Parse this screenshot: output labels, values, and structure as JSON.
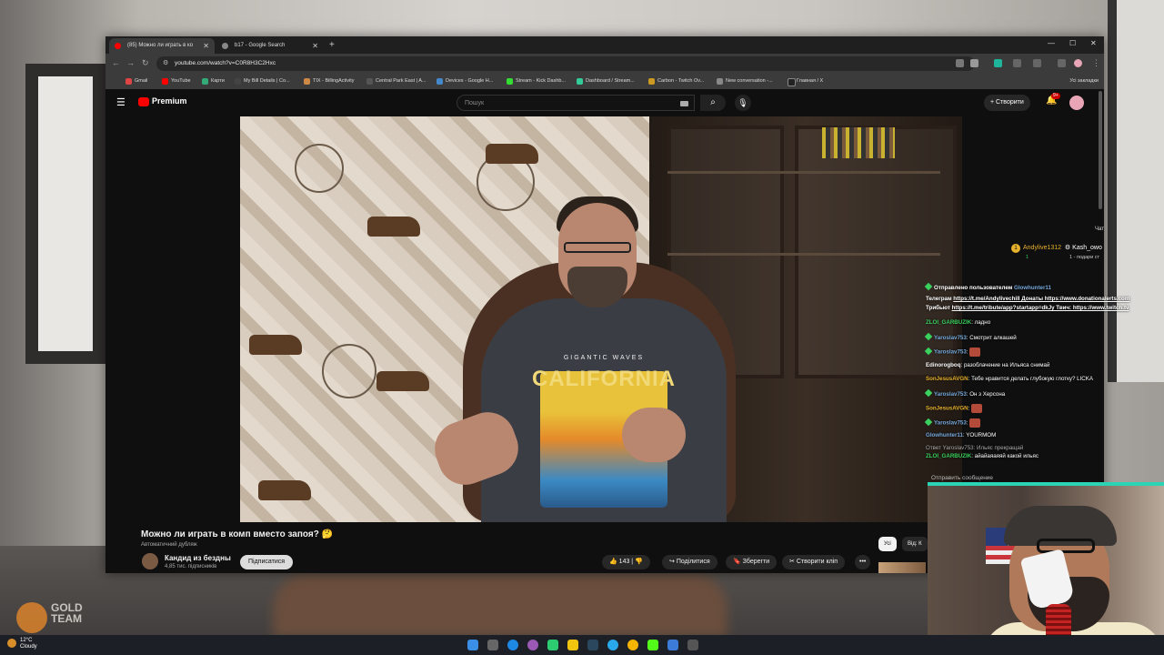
{
  "browser": {
    "tabs": [
      {
        "title": "(85) Можно ли играть в ко",
        "active": true
      },
      {
        "title": "b17 - Google Search",
        "active": false
      }
    ],
    "url": "youtube.com/watch?v=C0R8H3C2Hxc",
    "bookmarks": [
      "Gmail",
      "YouTube",
      "Карти",
      "My Bill Details | Co...",
      "TIX - BillingActivity",
      "Central Park East | A...",
      "Devices - Google H...",
      "Stream - Kick Dashb...",
      "Dashboard / Stream...",
      "Carbon - Twitch Ov...",
      "New conversation -...",
      "Главная / X"
    ],
    "all_bookmarks": "Усі закладки"
  },
  "youtube": {
    "logo": "Premium",
    "search_placeholder": "Пошук",
    "create_label": "Створити",
    "notif_count": "9+",
    "video_title": "Можно ли играть в комп вместо запоя? 🤔",
    "dub_note": "Автоматичний дубляж",
    "channel_name": "Кандид из бездны",
    "channel_subs": "4,85 тис. підписників",
    "subscribe_label": "Підписатися",
    "likes": "143",
    "share_label": "Поділитися",
    "save_label": "Зберегти",
    "clip_label": "Створити кліп",
    "more": "•••",
    "chip_all": "Усі",
    "chip_from": "Від: К"
  },
  "video_frame": {
    "shirt_sub": "GIGANTIC WAVES",
    "shirt_text": "CALIFORNIA"
  },
  "chat": {
    "label": "Чат",
    "gift_user": "Andylive1312",
    "gift_count": "1",
    "gift_target": "Kash_owo",
    "gift_note": "1 - подари ст",
    "lines": [
      {
        "user": "Отправлено пользователем",
        "text": " Glowhunter11"
      },
      {
        "user": "Телеграм ",
        "text": "https://t.me/Andylivechill Донаты https://www.donationalerts.com"
      },
      {
        "user": "Трибьют ",
        "text": "https://t.me/tribute/app?startapp=dkJy Твич: https://www.twitch.tv"
      },
      {
        "user": "ZLOI_GARBUZIK",
        "text": ": ладно"
      },
      {
        "user": "Yaroslav753",
        "text": ": Смотрит алкашей"
      },
      {
        "user": "Yaroslav753",
        "text": ":"
      },
      {
        "user": "Edinorogboq",
        "text": ": разоблачение на Ильяса снимай"
      },
      {
        "user": "SonJesusAVGN",
        "text": ": Тебе нравится делать глубокую глотку? LICKA"
      },
      {
        "user": "Yaroslav753",
        "text": ": Он з Херсона"
      },
      {
        "user": "SonJesusAVGN",
        "text": ":"
      },
      {
        "user": "Yaroslav753",
        "text": ":"
      },
      {
        "user": "Glowhunter11",
        "text": ": YOURMOM"
      },
      {
        "user": "Ответ Yaroslav753:",
        "text": " Ильяс прекращай"
      },
      {
        "user": "ZLOI_GARBUZIK",
        "text": ": айайаяаяяй какой ильяс"
      }
    ],
    "send_placeholder": "Отправить сообщение"
  },
  "overlay": {
    "logo_text": "GOLD TEAM"
  },
  "taskbar": {
    "temp": "12°C",
    "weather": "Cloudy"
  }
}
